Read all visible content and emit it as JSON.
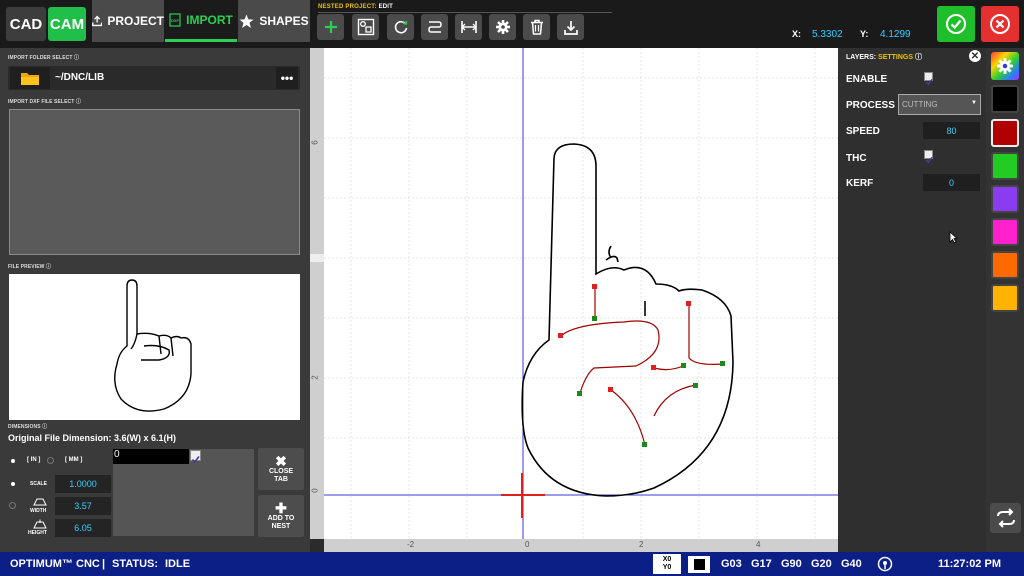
{
  "header": {
    "cad_label": "CAD",
    "cam_label": "CAM",
    "tabs": {
      "project": "PROJECT",
      "import": "IMPORT",
      "shapes": "SHAPES"
    },
    "nested_prefix": "NESTED PROJECT:",
    "nested_mode": "EDIT",
    "coords": {
      "x_label": "X:",
      "x_value": "5.3302",
      "y_label": "Y:",
      "y_value": "4.1299"
    }
  },
  "left_panel": {
    "import_folder_label": "IMPORT FOLDER SELECT",
    "folder_path": "~/DNC/LIB",
    "dots_label": "•••",
    "dxf_select_label": "IMPORT DXF FILE SELECT",
    "preview_label": "FILE PREVIEW",
    "dimensions_label": "DIMENSIONS",
    "original_dimension": "Original File Dimension: 3.6(W) x 6.1(H)",
    "unit_in": "[ IN ]",
    "unit_mm": "[ MM ]",
    "scale_label": "SCALE",
    "scale_value": "1.0000",
    "width_label": "WIDTH",
    "width_value": "3.57",
    "height_label": "HEIGHT",
    "height_value": "6.05",
    "entry_value": "0",
    "close_tab_label_1": "CLOSE",
    "close_tab_label_2": "TAB",
    "add_to_nest_label_1": "ADD TO",
    "add_to_nest_label_2": "NEST"
  },
  "ruler": {
    "x_ticks": [
      "-2",
      "0",
      "2",
      "4"
    ],
    "y_ticks": [
      "0",
      "2",
      "4",
      "6"
    ]
  },
  "right_panel": {
    "layers_label": "LAYERS:",
    "settings_label": "SETTINGS",
    "enable_label": "ENABLE",
    "process_label": "PROCESS",
    "process_value": "CUTTING",
    "speed_label": "SPEED",
    "speed_value": "80",
    "thc_label": "THC",
    "kerf_label": "KERF",
    "kerf_value": "0"
  },
  "colors": {
    "swatches": [
      "#000000",
      "#b00000",
      "#22cc22",
      "#8a3cf0",
      "#ff22cc",
      "#ff6a00",
      "#ffb300"
    ],
    "accent": "#1fbf4a",
    "danger": "#e53030",
    "status_bar": "#0c1f86"
  },
  "status_bar": {
    "brand": "OPTIMUM™ CNC",
    "separator": "|",
    "status_label": "STATUS:",
    "status_value": "IDLE",
    "gcodes": [
      "G03",
      "G17",
      "G90",
      "G20",
      "G40"
    ],
    "time": "11:27:02 PM"
  }
}
